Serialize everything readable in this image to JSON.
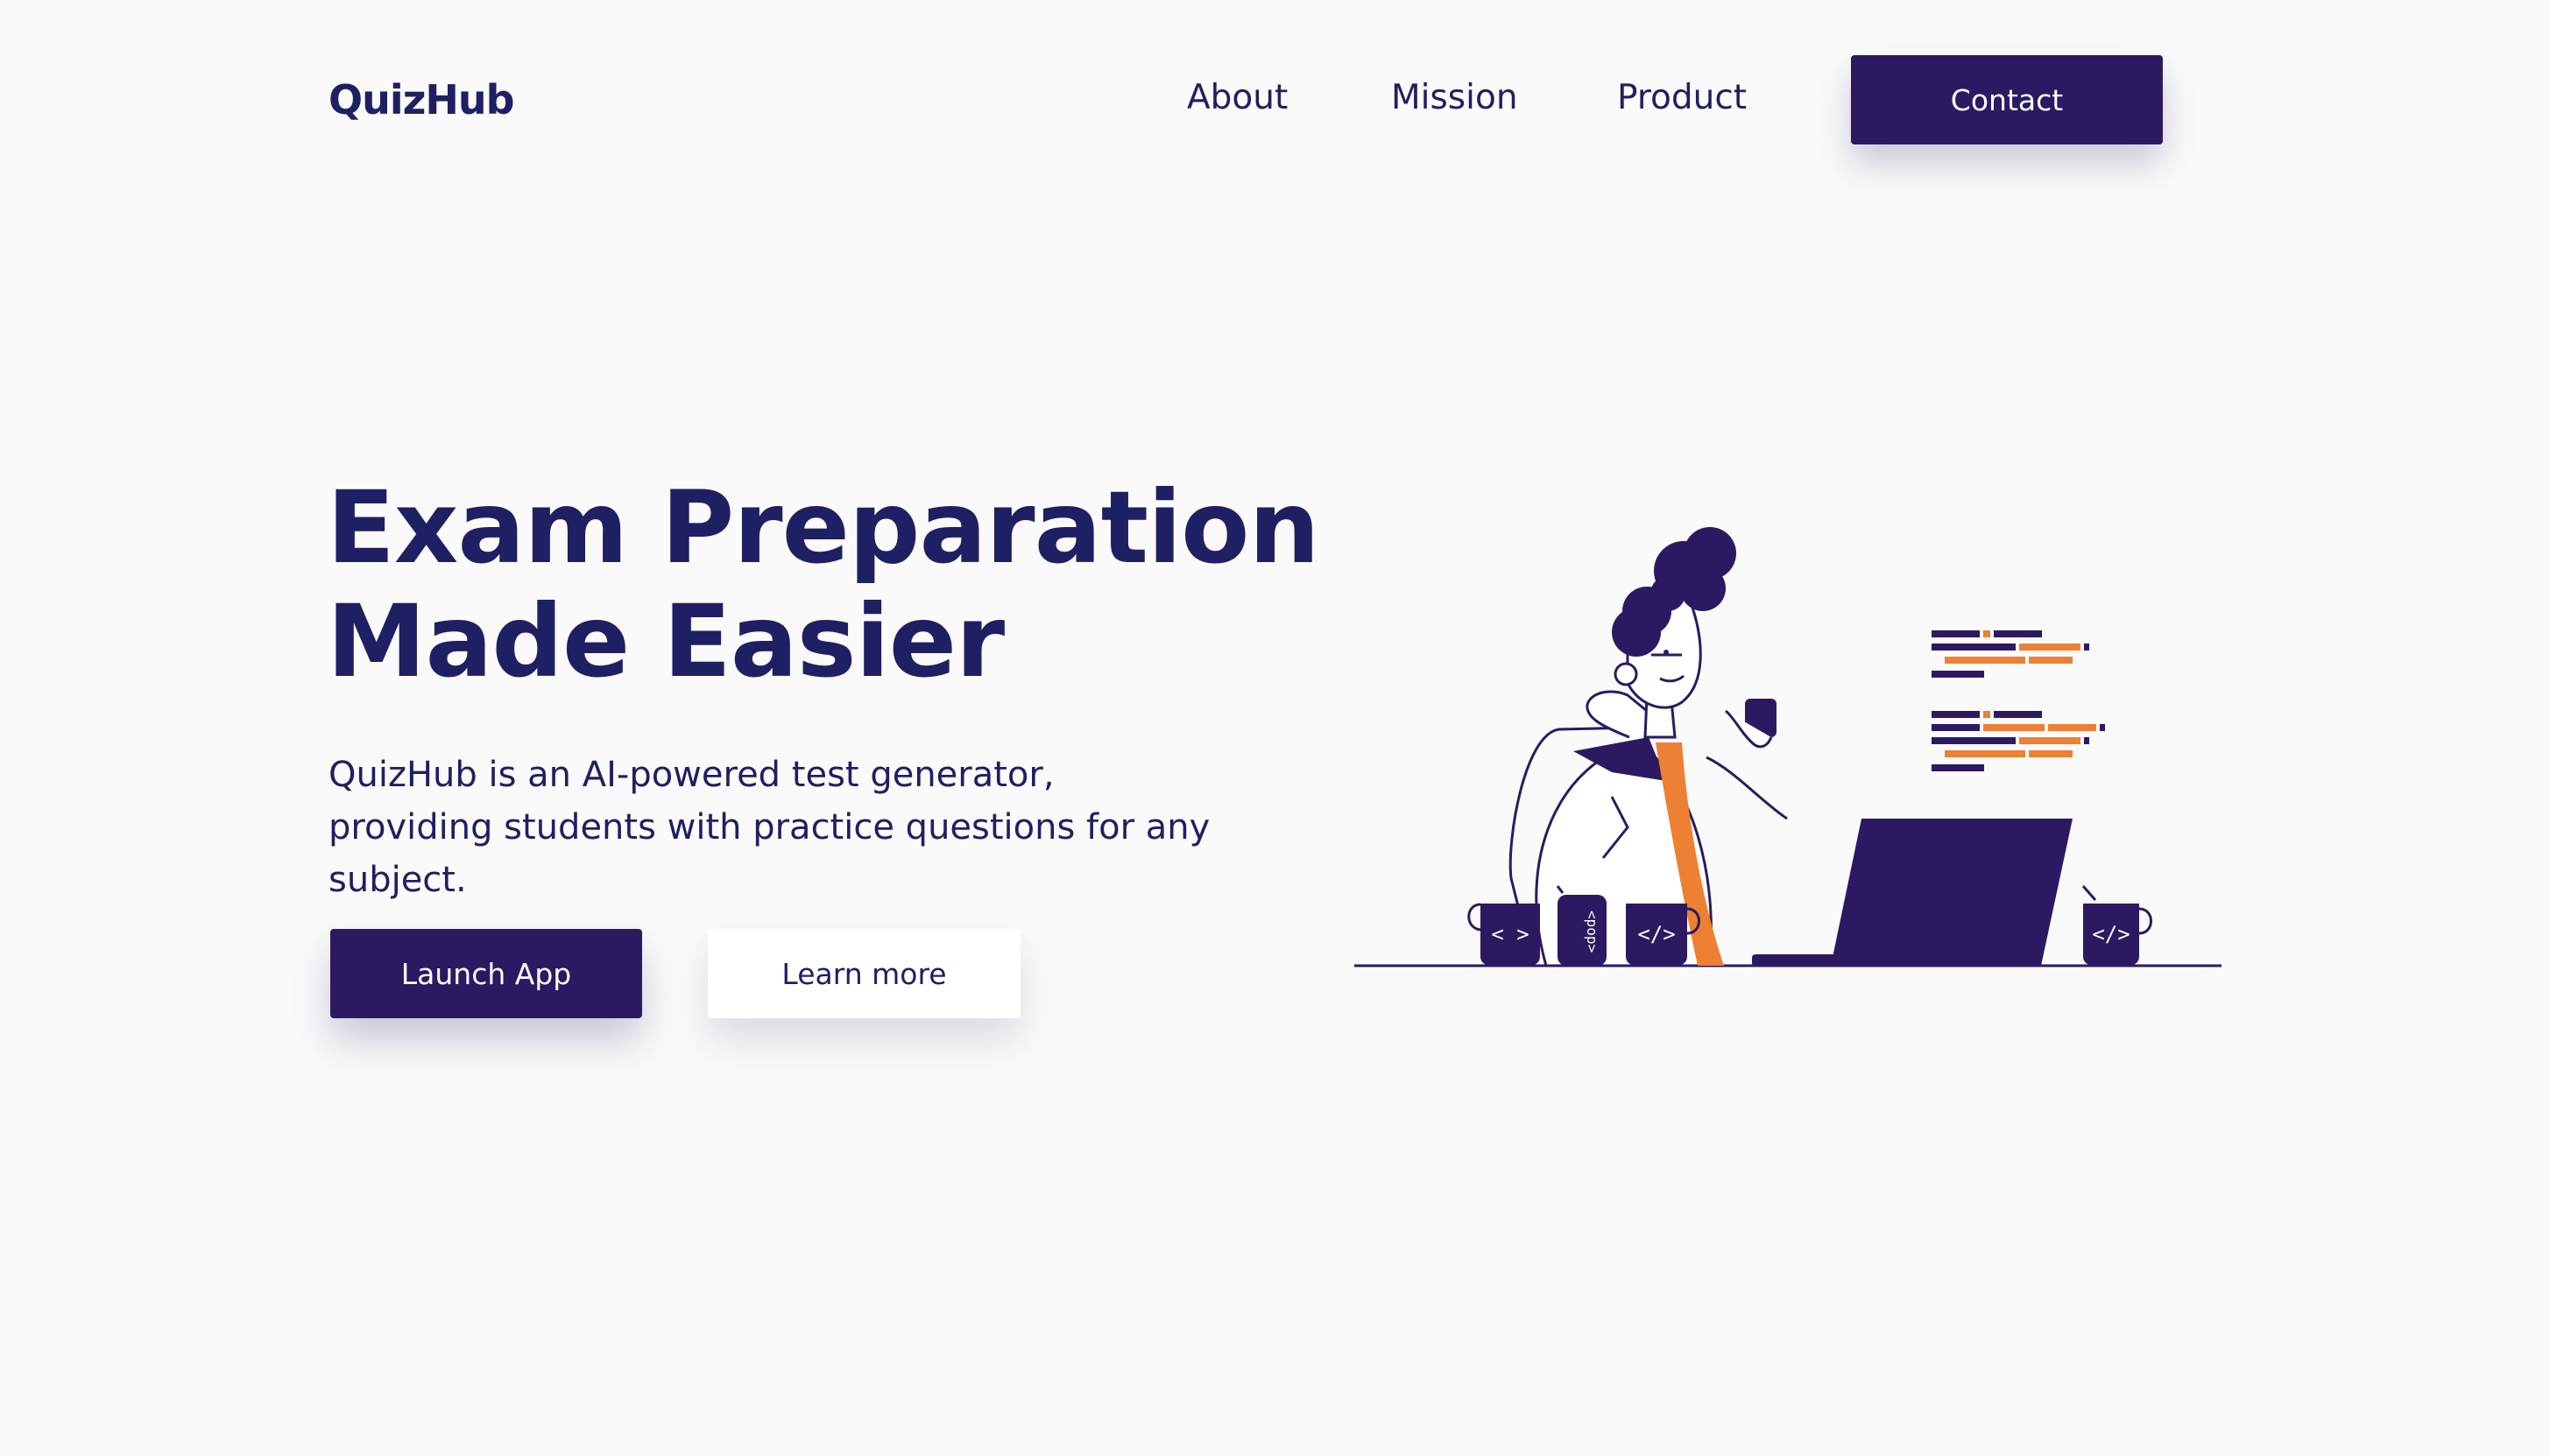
{
  "app": {
    "name": "QuizHub"
  },
  "nav": {
    "items": [
      {
        "label": "About"
      },
      {
        "label": "Mission"
      },
      {
        "label": "Product"
      }
    ],
    "contact_label": "Contact"
  },
  "hero": {
    "headline_line1": "Exam Preparation",
    "headline_line2": "Made Easier",
    "description": "QuizHub is an AI-powered test generator, providing students with practice questions for any subject.",
    "primary_button": "Launch App",
    "secondary_button": "Learn more"
  },
  "illustration": {
    "subject": "developer-at-desk-with-laptop",
    "mug_left_label": "< >",
    "can_label": "<pop>",
    "mug_middle_label": "</>",
    "mug_right_label": "</>"
  },
  "colors": {
    "background": "#fafafa",
    "primary": "#2b1a62",
    "text": "#1f1f63",
    "accent": "#ee8033",
    "white": "#ffffff"
  }
}
